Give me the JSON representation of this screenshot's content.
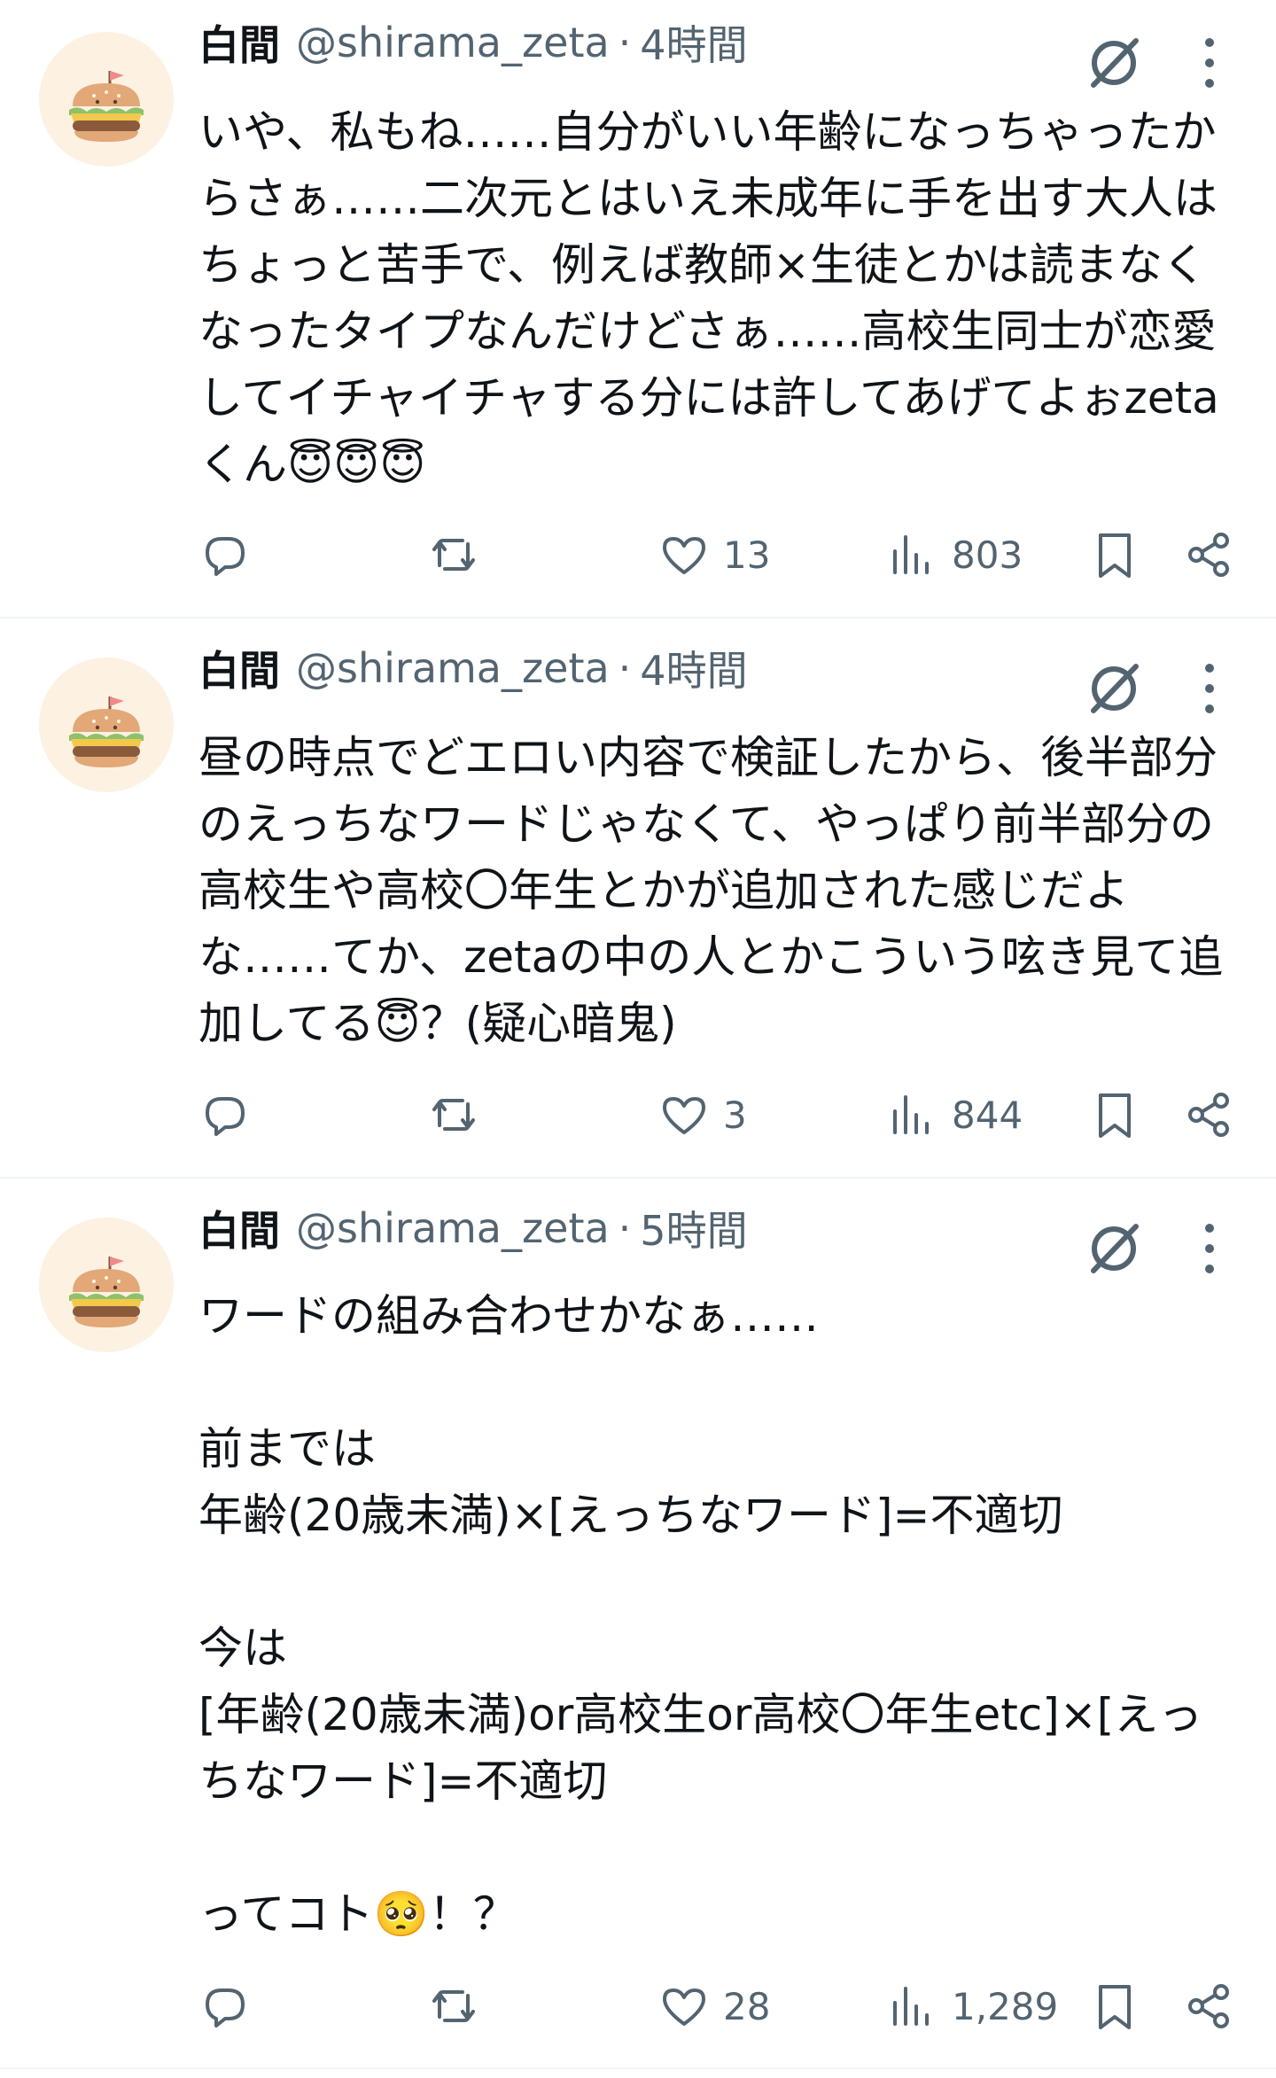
{
  "tweets": [
    {
      "display_name": "白間",
      "handle": "@shirama_zeta",
      "separator": "·",
      "time": "4時間",
      "text": "いや、私もね……自分がいい年齢になっちゃったからさぁ……二次元とはいえ未成年に手を出す大人はちょっと苦手で、例えば教師×生徒とかは読まなくなったタイプなんだけどさぁ……高校生同士が恋愛してイチャイチャする分には許してあげてよぉzetaくん😇😇😇",
      "replies": "",
      "reposts": "",
      "likes": "13",
      "views": "803"
    },
    {
      "display_name": "白間",
      "handle": "@shirama_zeta",
      "separator": "·",
      "time": "4時間",
      "text": "昼の時点でどエロい内容で検証したから、後半部分のえっちなワードじゃなくて、やっぱり前半部分の高校生や高校〇年生とかが追加された感じだよな……てか、zetaの中の人とかこういう呟き見て追加してる😇？(疑心暗鬼)",
      "replies": "",
      "reposts": "",
      "likes": "3",
      "views": "844"
    },
    {
      "display_name": "白間",
      "handle": "@shirama_zeta",
      "separator": "·",
      "time": "5時間",
      "text": "ワードの組み合わせかなぁ……\n\n前までは\n年齢(20歳未満)×[えっちなワード]=不適切\n\n今は\n[年齢(20歳未満)or高校生or高校〇年生etc]×[えっちなワード]=不適切\n\nってコト🥺！？",
      "replies": "",
      "reposts": "",
      "likes": "28",
      "views": "1,289"
    }
  ],
  "icons": {
    "avatar": "burger-with-flag-avatar",
    "grok": "grok-slash-circle-icon",
    "more": "more-vertical-icon",
    "reply": "reply-bubble-icon",
    "repost": "repost-arrows-icon",
    "like": "heart-icon",
    "views": "bar-chart-icon",
    "bookmark": "bookmark-icon",
    "share": "share-icon"
  },
  "colors": {
    "text": "#0f1419",
    "secondary": "#536471",
    "divider": "#eff3f4",
    "avatar_bg": "#fdf1e2"
  }
}
